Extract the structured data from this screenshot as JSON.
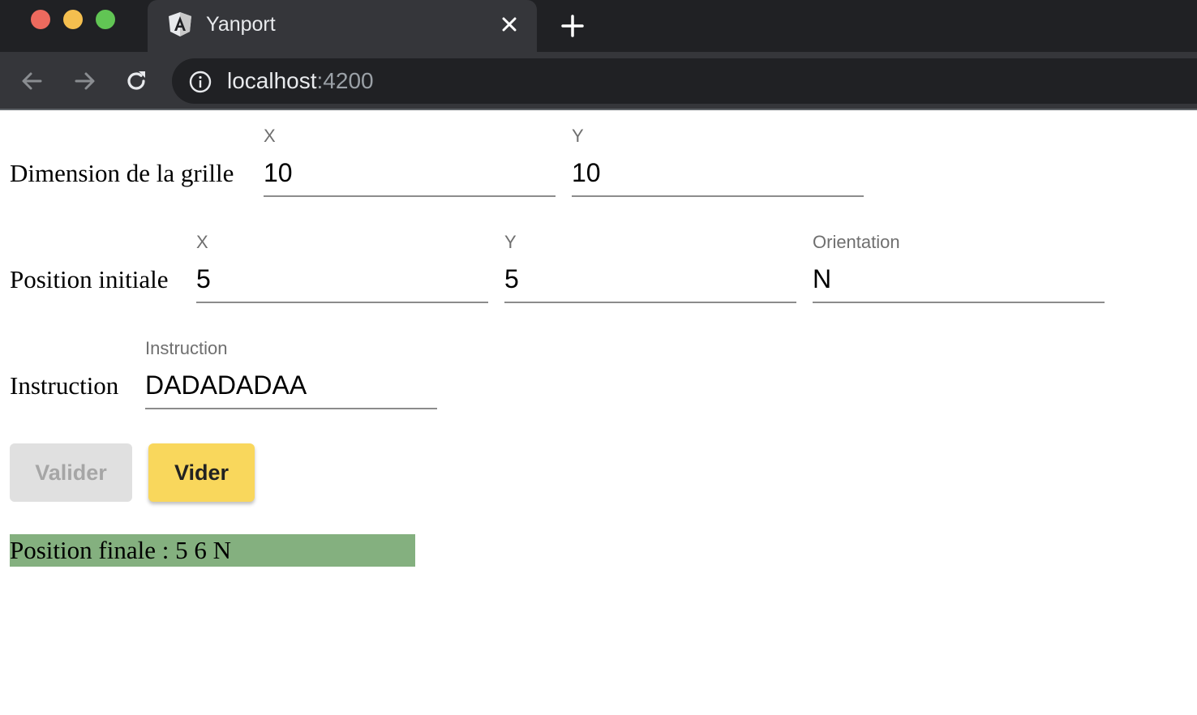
{
  "browser": {
    "tab_title": "Yanport",
    "url_host": "localhost",
    "url_port": ":4200",
    "colors": {
      "frame": "#202124",
      "tab": "#35363a"
    },
    "icons": [
      "angular-favicon-icon",
      "close-icon",
      "plus-icon",
      "back-arrow-icon",
      "forward-arrow-icon",
      "reload-icon",
      "info-icon"
    ]
  },
  "grid": {
    "label": "Dimension de la grille",
    "x": {
      "label": "X",
      "value": "10"
    },
    "y": {
      "label": "Y",
      "value": "10"
    }
  },
  "initial": {
    "label": "Position initiale",
    "x": {
      "label": "X",
      "value": "5"
    },
    "y": {
      "label": "Y",
      "value": "5"
    },
    "orientation": {
      "label": "Orientation",
      "value": "N"
    }
  },
  "instruction": {
    "label": "Instruction",
    "field_label": "Instruction",
    "value": "DADADADAA"
  },
  "buttons": {
    "valider": "Valider",
    "vider": "Vider"
  },
  "result": {
    "text": "Position finale : 5 6 N",
    "color": "#84b07f"
  },
  "accent_color": "#f9d75c"
}
